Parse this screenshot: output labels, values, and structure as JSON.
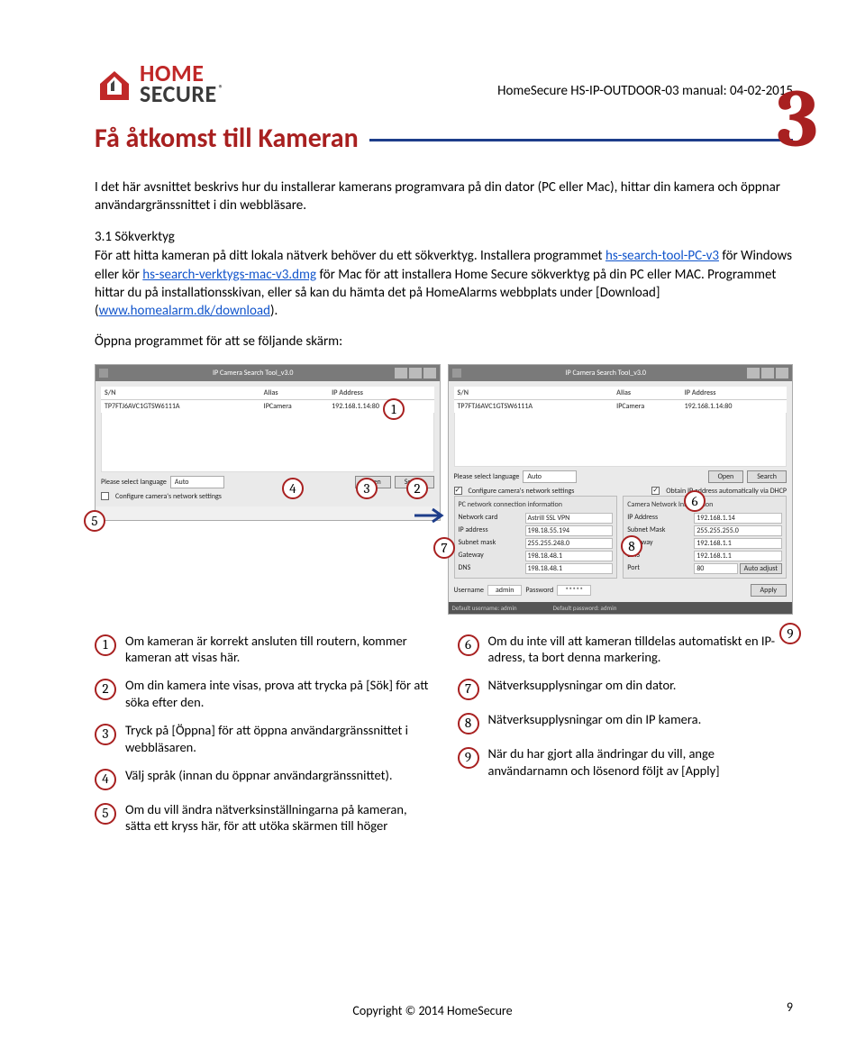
{
  "header": {
    "logo_home": "HOME",
    "logo_secure": "SECURE",
    "doc_id": "HomeSecure HS-IP-OUTDOOR-03 manual: 04-02-2015"
  },
  "section": {
    "title": "Få åtkomst till Kameran",
    "number": "3"
  },
  "intro": "I det här avsnittet beskrivs hur du installerar kamerans programvara på din dator (PC eller Mac), hittar din kamera och öppnar användargränssnittet i din webbläsare.",
  "sub_heading": "3.1 Sökverktyg",
  "body1_a": "För att hitta kameran på ditt lokala nätverk behöver du ett sökverktyg. Installera programmet ",
  "body1_link1": "hs-search-tool-PC-v3",
  "body1_b": " för Windows eller kör ",
  "body1_link2": "hs-search-verktygs-mac-v3.dmg",
  "body1_c": " för Mac för att installera Home Secure sökverktyg på din PC eller MAC. Programmet hittar du på installationsskivan, eller så kan du hämta det på HomeAlarms webbplats under [Download] (",
  "body1_link3": "www.homealarm.dk/download",
  "body1_d": ").",
  "body2": "Öppna programmet för att se följande skärm:",
  "screenshot": {
    "win_title": "IP Camera Search Tool_v3.0",
    "col_sn": "S/N",
    "col_alias": "Alias",
    "col_ip": "IP Address",
    "row_sn": "TP7FTJ6AVC1GTSW6111A",
    "row_alias": "IPCamera",
    "row_ip": "192.168.1.14:80",
    "lang_label": "Please select language",
    "lang_val": "Auto",
    "btn_open": "Open",
    "btn_search": "Search",
    "chk_config": "Configure camera's network settings",
    "chk_dhcp": "Obtain IP address automatically via DHCP",
    "panel1_title": "PC network connection information",
    "panel2_title": "Camera Network Information",
    "f_netcard": "Network card",
    "v_netcard": "Astrill SSL VPN",
    "f_ipaddr": "IP address",
    "v_ipaddr": "198.18.55.194",
    "f_subnet": "Subnet mask",
    "v_subnet": "255.255.248.0",
    "f_gateway": "Gateway",
    "v_gateway": "198.18.48.1",
    "f_dns": "DNS",
    "v_dns": "198.18.48.1",
    "c_ipaddr": "IP Address",
    "cv_ipaddr": "192.168.1.14",
    "c_subnet": "Subnet Mask",
    "cv_subnet": "255.255.255.0",
    "c_gateway": "Gateway",
    "cv_gateway": "192.168.1.1",
    "c_dns": "DNS",
    "cv_dns": "192.168.1.1",
    "c_port": "Port",
    "cv_port": "80",
    "auto_adjust": "Auto adjust",
    "user_label": "Username",
    "user_val": "admin",
    "pass_label": "Password",
    "pass_val": "*****",
    "apply": "Apply",
    "def_user": "Default username: admin",
    "def_pass": "Default password: admin"
  },
  "legend": {
    "l1": "Om kameran är korrekt ansluten till routern, kommer kameran att visas här.",
    "l2": "Om din kamera inte visas, prova att trycka på [Sök] för att söka efter den.",
    "l3": "Tryck på [Öppna] för att öppna användargränssnittet i webbläsaren.",
    "l4": "Välj språk (innan du öppnar användargränssnittet).",
    "l5": "Om du vill ändra nätverksinställningarna på kameran, sätta ett kryss här, för att utöka skärmen till höger",
    "l6": "Om du inte vill att kameran tilldelas automatiskt en IP-adress, ta bort denna markering.",
    "l7": "Nätverksupplysningar om din dator.",
    "l8": "Nätverksupplysningar om din IP kamera.",
    "l9": "När du har gjort alla ändringar du vill, ange användarnamn och lösenord följt av [Apply]"
  },
  "footer": "Copyright © 2014 HomeSecure",
  "page_number": "9"
}
